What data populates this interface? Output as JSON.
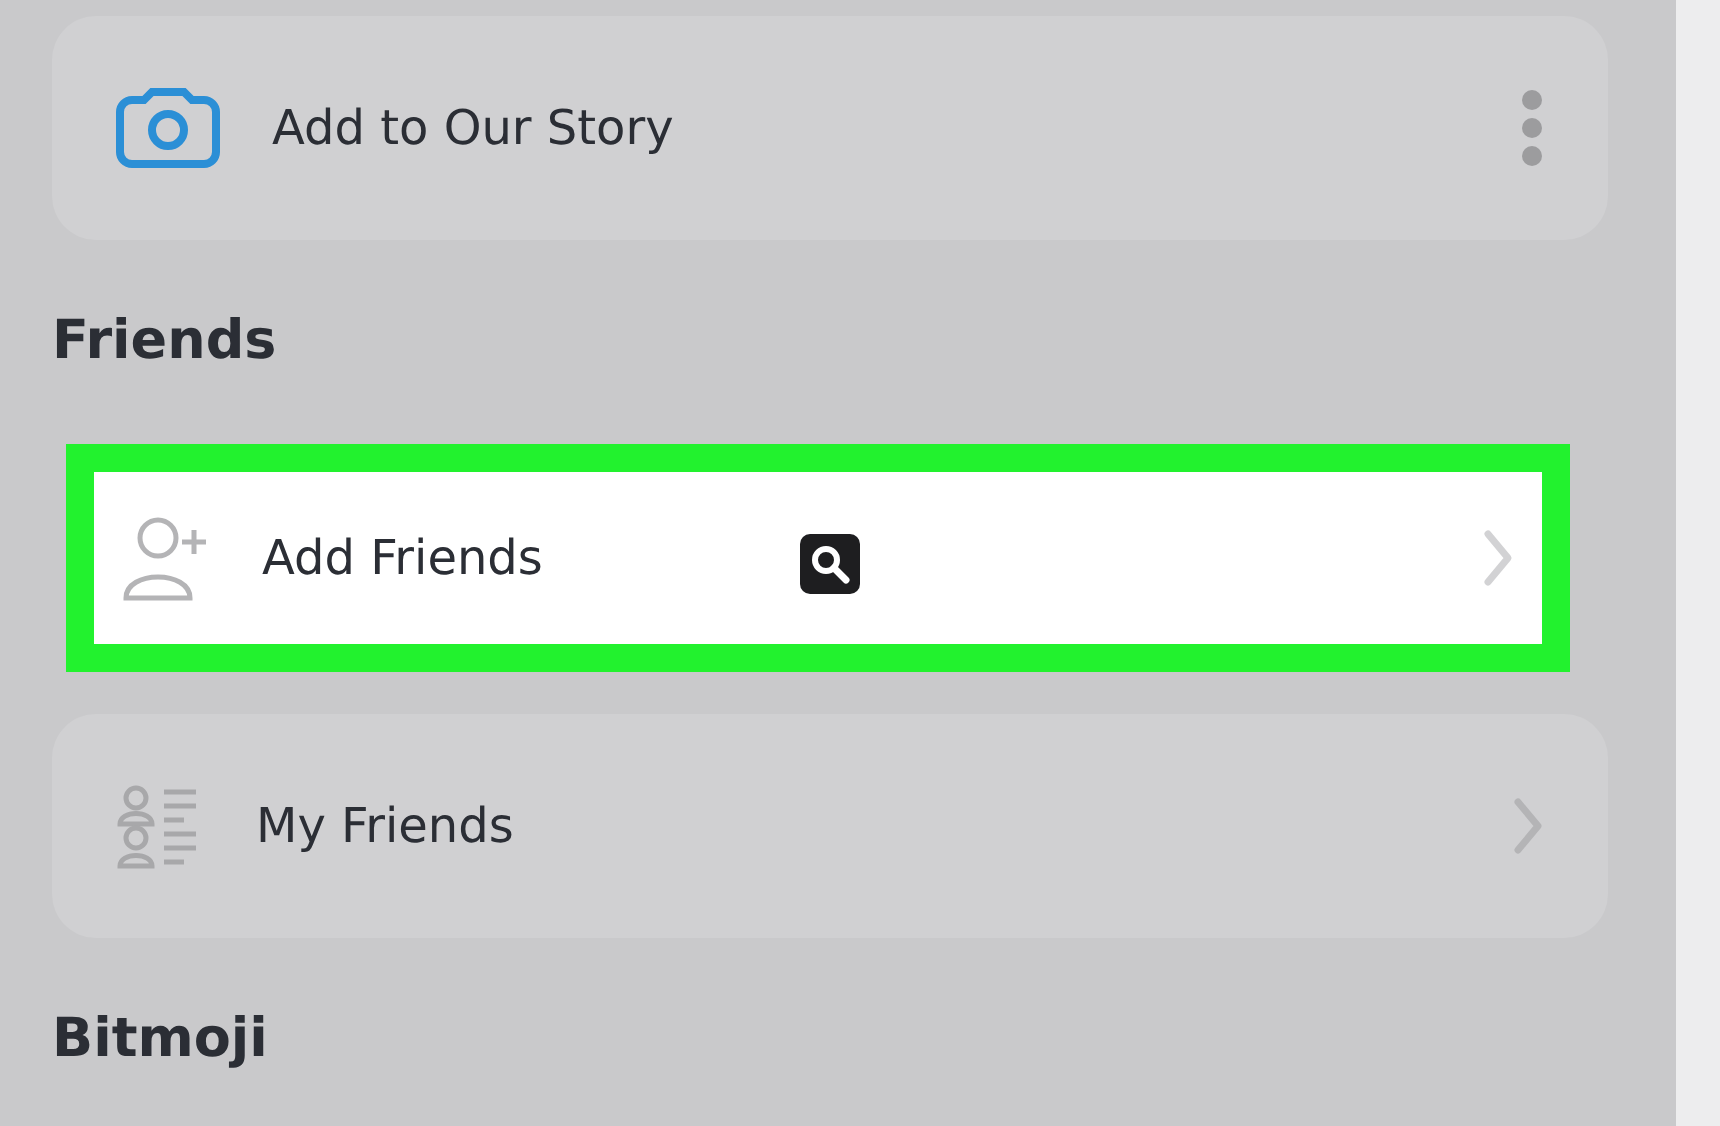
{
  "sections": [
    {
      "items": [
        {
          "label": "Add to Our Story",
          "kind": "story",
          "highlighted": false
        }
      ]
    },
    {
      "title": "Friends",
      "items": [
        {
          "label": "Add Friends",
          "kind": "add-friend",
          "highlighted": true
        },
        {
          "label": "My Friends",
          "kind": "friend-list",
          "highlighted": false
        }
      ]
    },
    {
      "title": "Bitmoji"
    }
  ]
}
